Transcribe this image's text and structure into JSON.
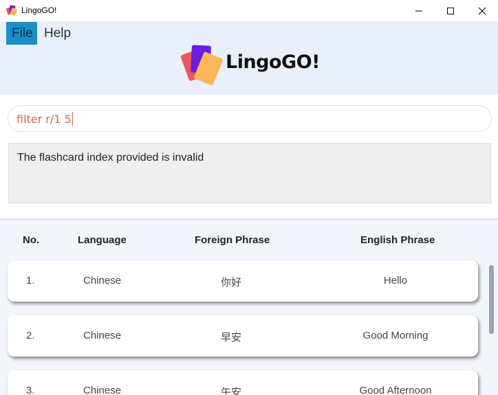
{
  "window": {
    "title": "LingoGO!",
    "app_icon": "lingogo-app-icon",
    "controls": [
      "minimize-icon",
      "maximize-icon",
      "close-icon"
    ]
  },
  "menu": {
    "items": [
      {
        "label": "File",
        "selected": true
      },
      {
        "label": "Help",
        "selected": false
      }
    ]
  },
  "logo": {
    "text": "LingoGO!",
    "colors": {
      "red": "#f0545f",
      "purple": "#6b1de0",
      "orange": "#fdb65a"
    }
  },
  "command": {
    "value": "filter r/1 5"
  },
  "result": {
    "message": "The flashcard index provided is invalid"
  },
  "table": {
    "headers": {
      "no": "No.",
      "language": "Language",
      "foreign": "Foreign Phrase",
      "english": "English Phrase"
    },
    "rows": [
      {
        "no": "1.",
        "language": "Chinese",
        "foreign": "你好",
        "english": "Hello"
      },
      {
        "no": "2.",
        "language": "Chinese",
        "foreign": "早安",
        "english": "Good Morning"
      },
      {
        "no": "3.",
        "language": "Chinese",
        "foreign": "午安",
        "english": "Good Afternoon"
      }
    ]
  },
  "colors": {
    "header_bg": "#e9f0fb",
    "menu_selected_bg": "#1a8fc9",
    "command_text": "#c8694f",
    "list_bg": "#f2f5fa"
  }
}
